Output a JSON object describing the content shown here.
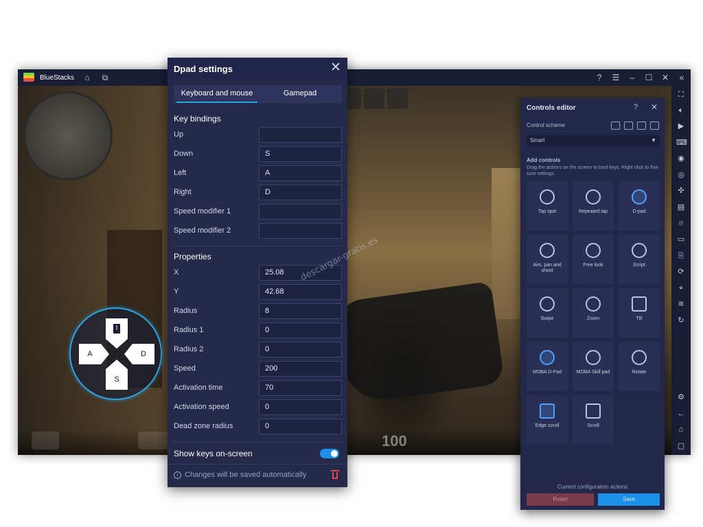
{
  "app": {
    "name": "BlueStacks",
    "titlebar_icons": [
      "home-icon",
      "multi-instance-icon"
    ],
    "window_controls": [
      "help-icon",
      "menu-icon",
      "minimize-icon",
      "maximize-icon",
      "close-icon",
      "collapse-icon"
    ]
  },
  "sidebar_icons": [
    "fullscreen-icon",
    "volume-icon",
    "media-icon",
    "keyboard-icon",
    "record-icon",
    "macro-icon",
    "gamepad-icon",
    "screenshot-icon",
    "camera-icon",
    "folder-icon",
    "apk-icon",
    "eco-icon",
    "location-icon",
    "layers-icon",
    "sync-icon",
    "settings-icon",
    "back-icon",
    "home-icon",
    "recent-icon"
  ],
  "game_hud": {
    "ammo": "100"
  },
  "dpad_overlay": {
    "up": "I",
    "down": "S",
    "left": "A",
    "right": "D"
  },
  "dpad_settings": {
    "title": "Dpad settings",
    "tabs": [
      "Keyboard and mouse",
      "Gamepad"
    ],
    "active_tab": "Keyboard and mouse",
    "key_bindings_title": "Key bindings",
    "key_bindings": [
      {
        "label": "Up",
        "value": ""
      },
      {
        "label": "Down",
        "value": "S"
      },
      {
        "label": "Left",
        "value": "A"
      },
      {
        "label": "Right",
        "value": "D"
      },
      {
        "label": "Speed modifier 1",
        "value": ""
      },
      {
        "label": "Speed modifier 2",
        "value": ""
      }
    ],
    "properties_title": "Properties",
    "properties": [
      {
        "label": "X",
        "value": "25.08"
      },
      {
        "label": "Y",
        "value": "42.68"
      },
      {
        "label": "Radius",
        "value": "8"
      },
      {
        "label": "Radius 1",
        "value": "0"
      },
      {
        "label": "Radius 2",
        "value": "0"
      },
      {
        "label": "Speed",
        "value": "200"
      },
      {
        "label": "Activation time",
        "value": "70"
      },
      {
        "label": "Activation speed",
        "value": "0"
      },
      {
        "label": "Dead zone radius",
        "value": "0"
      }
    ],
    "show_keys_label": "Show keys on-screen",
    "show_keys_on": true,
    "footer_info": "Changes will be saved automatically"
  },
  "controls_editor": {
    "title": "Controls editor",
    "scheme_label": "Control scheme",
    "scheme_value": "Smart",
    "add_controls_label": "Add controls",
    "add_controls_help": "Drag the actions on the screen to bind keys. Right click to fine-tune settings.",
    "tiles": [
      {
        "label": "Tap spot",
        "icon": "tap-spot-icon"
      },
      {
        "label": "Repeated tap",
        "icon": "repeated-tap-icon"
      },
      {
        "label": "D-pad",
        "icon": "dpad-icon"
      },
      {
        "label": "Aim, pan and shoot",
        "icon": "aim-icon"
      },
      {
        "label": "Free look",
        "icon": "free-look-icon"
      },
      {
        "label": "Script",
        "icon": "script-icon"
      },
      {
        "label": "Swipe",
        "icon": "swipe-icon"
      },
      {
        "label": "Zoom",
        "icon": "zoom-icon"
      },
      {
        "label": "Tilt",
        "icon": "tilt-icon"
      },
      {
        "label": "MOBA D-Pad",
        "icon": "moba-dpad-icon"
      },
      {
        "label": "MOBA Skill pad",
        "icon": "moba-skill-icon"
      },
      {
        "label": "Rotate",
        "icon": "rotate-icon"
      },
      {
        "label": "Edge scroll",
        "icon": "edge-scroll-icon"
      },
      {
        "label": "Scroll",
        "icon": "scroll-icon"
      }
    ],
    "footer_label": "Current configuration actions",
    "reset_label": "Reset",
    "save_label": "Save"
  },
  "watermark": "descargar-gratis.es",
  "colors": {
    "accent": "#29a6e8",
    "panel": "#25294a",
    "danger": "#e8434b",
    "save": "#1a8fe8"
  }
}
